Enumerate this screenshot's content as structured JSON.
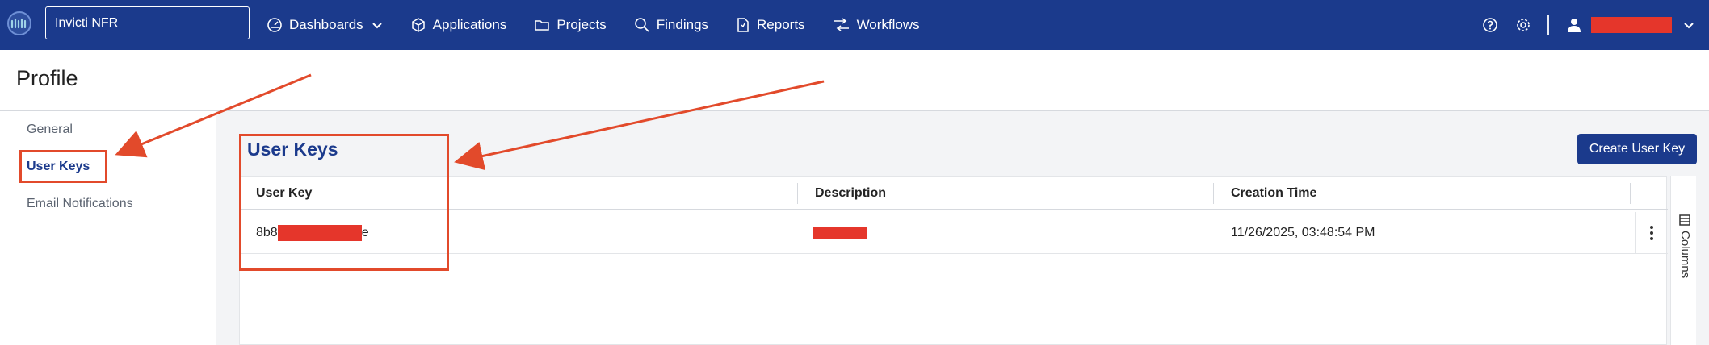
{
  "topbar": {
    "org_name": "Invicti NFR",
    "nav": [
      {
        "label": "Dashboards",
        "icon": "dashboard-icon"
      },
      {
        "label": "Applications",
        "icon": "cube-icon"
      },
      {
        "label": "Projects",
        "icon": "folder-icon"
      },
      {
        "label": "Findings",
        "icon": "search-icon"
      },
      {
        "label": "Reports",
        "icon": "report-icon"
      },
      {
        "label": "Workflows",
        "icon": "workflow-icon"
      }
    ]
  },
  "page": {
    "title": "Profile"
  },
  "sidebar": {
    "items": [
      {
        "label": "General"
      },
      {
        "label": "User Keys"
      },
      {
        "label": "Email Notifications"
      }
    ]
  },
  "main": {
    "section_title": "User Keys",
    "create_button": "Create User Key",
    "columns_label": "Columns",
    "table": {
      "headers": [
        "User Key",
        "Description",
        "Creation Time"
      ],
      "rows": [
        {
          "key_prefix": "8b8",
          "key_suffix": "e",
          "creation_time": "11/26/2025, 03:48:54 PM"
        }
      ]
    }
  },
  "colors": {
    "brand": "#1b3a8c",
    "annotation": "#e24a2b",
    "redaction": "#e5362b"
  }
}
